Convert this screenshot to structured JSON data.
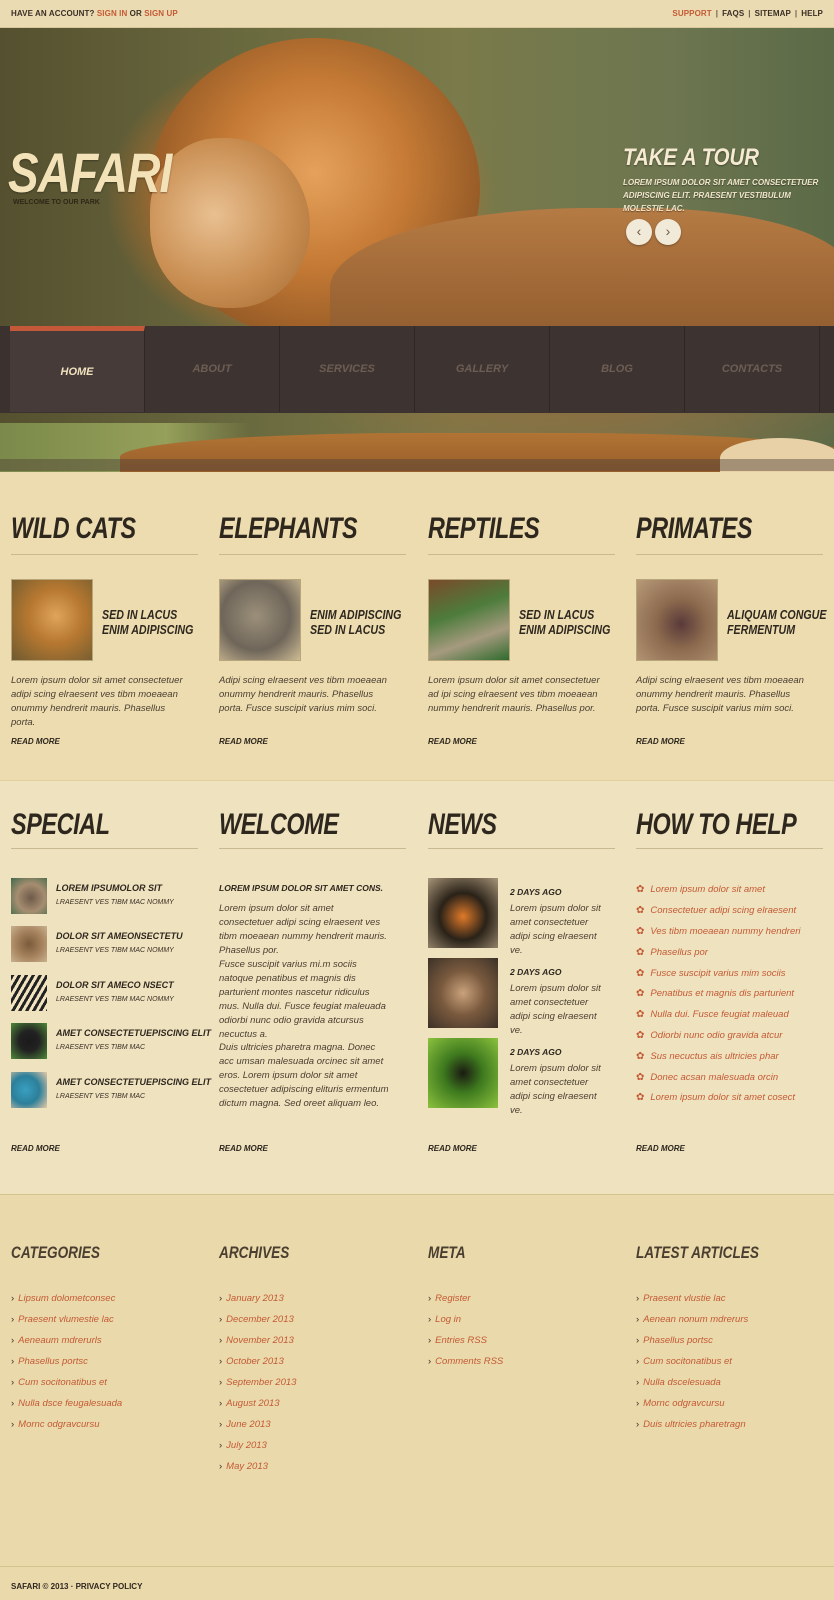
{
  "topbar": {
    "account_prefix": "HAVE AN ACCOUNT?",
    "sign_in": "SIGN IN",
    "or": "OR",
    "sign_up": "SIGN UP",
    "links": [
      "SUPPORT",
      "FAQS",
      "SITEMAP",
      "HELP"
    ]
  },
  "hero": {
    "logo": "SAFARI",
    "tagline": "WELCOME TO OUR PARK",
    "tour_title": "TAKE A TOUR",
    "tour_text": "LOREM IPSUM DOLOR SIT AMET CONSECTETUER ADIPISCING ELIT. PRAESENT VESTIBULUM MOLESTIE LAC.",
    "prev_icon": "‹",
    "next_icon": "›"
  },
  "nav": {
    "items": [
      "HOME",
      "ABOUT",
      "SERVICES",
      "GALLERY",
      "BLOG",
      "CONTACTS"
    ],
    "active": "HOME"
  },
  "categories": [
    {
      "heading": "WILD CATS",
      "title1": "SED IN LACUS",
      "title2": "ENIM ADIPISCING",
      "text": "Lorem ipsum dolor sit amet consectetuer adipi scing elraesent ves tibm moeaean onummy hendrerit mauris. Phasellus porta.",
      "read_more": "READ MORE"
    },
    {
      "heading": "ELEPHANTS",
      "title1": "ENIM ADIPISCING",
      "title2": "SED IN LACUS",
      "text": "Adipi scing elraesent ves tibm moeaean onummy hendrerit mauris. Phasellus porta. Fusce suscipit varius mim soci.",
      "read_more": "READ MORE"
    },
    {
      "heading": "REPTILES",
      "title1": "SED IN LACUS",
      "title2": "ENIM ADIPISCING",
      "text": "Lorem ipsum dolor sit amet consectetuer ad ipi scing elraesent ves tibm moeaean nummy hendrerit mauris. Phasellus por.",
      "read_more": "READ MORE"
    },
    {
      "heading": "PRIMATES",
      "title1": "ALIQUAM CONGUE",
      "title2": "FERMENTUM",
      "text": "Adipi scing elraesent ves tibm moeaean onummy hendrerit mauris. Phasellus porta. Fusce suscipit varius mim soci.",
      "read_more": "READ MORE"
    }
  ],
  "special": {
    "heading": "SPECIAL",
    "items": [
      {
        "title": "LOREM IPSUMOLOR SIT",
        "sub": "LRAESENT VES TIBM MAC NOMMY"
      },
      {
        "title": "DOLOR SIT AMEONSECTETU",
        "sub": "LRAESENT VES TIBM MAC NOMMY"
      },
      {
        "title": "DOLOR SIT AMECO NSECT",
        "sub": "LRAESENT VES TIBM MAC NOMMY"
      },
      {
        "title": "AMET CONSECTETUEPISCING ELIT",
        "sub": "LRAESENT VES TIBM MAC"
      },
      {
        "title": "AMET CONSECTETUEPISCING ELIT",
        "sub": "LRAESENT VES TIBM MAC"
      }
    ],
    "read_more": "READ MORE"
  },
  "welcome": {
    "heading": "WELCOME",
    "lead": "LOREM IPSUM DOLOR SIT AMET CONS.",
    "p1": "Lorem ipsum dolor sit amet consectetuer adipi scing elraesent ves tibm moeaean nummy hendrerit mauris. Phasellus por.",
    "p2": "Fusce suscipit varius mi.m sociis natoque penatibus et magnis dis parturient montes nascetur ridiculus mus. Nulla dui. Fusce feugiat maleuada odiorbi nunc odio gravida atcursus necuctus a.",
    "p3": "Duis ultricies pharetra magna. Donec acc umsan malesuada orcinec sit amet eros. Lorem ipsum dolor sit amet cosectetuer adipiscing elituris ermentum dictum magna. Sed oreet aliquam leo.",
    "read_more": "READ MORE"
  },
  "news": {
    "heading": "NEWS",
    "items": [
      {
        "date": "2 DAYS AGO",
        "text": "Lorem ipsum dolor sit amet consectetuer adipi scing elraesent ve."
      },
      {
        "date": "2 DAYS AGO",
        "text": "Lorem ipsum dolor sit amet consectetuer adipi scing elraesent ve."
      },
      {
        "date": "2 DAYS AGO",
        "text": "Lorem ipsum dolor sit amet consectetuer adipi scing elraesent ve."
      }
    ],
    "read_more": "READ MORE"
  },
  "help": {
    "heading": "HOW TO HELP",
    "items": [
      "Lorem ipsum dolor sit amet",
      "Consectetuer adipi scing elraesent",
      "Ves tibm moeaean nummy hendreri",
      "Phasellus por",
      "Fusce suscipit varius mim sociis",
      "Penatibus et magnis dis parturient",
      "Nulla dui. Fusce feugiat maleuad",
      "Odiorbi nunc odio gravida atcur",
      "Sus necuctus ais ultricies phar",
      "Donec acsan malesuada orcin",
      "Lorem ipsum dolor sit amet cosect"
    ],
    "read_more": "READ MORE"
  },
  "footer_cols": {
    "categories": {
      "title": "CATEGORIES",
      "links": [
        "Lipsum dolometconsec",
        "Praesent vlumestie lac",
        "Aeneaum mdrerurls",
        "Phasellus portsc",
        "Cum socitonatibus et",
        "Nulla dsce feugalesuada",
        "Mornc odgravcursu"
      ]
    },
    "archives": {
      "title": "ARCHIVES",
      "links": [
        "January 2013",
        "December 2013",
        "November 2013",
        "October 2013",
        "September 2013",
        "August 2013",
        "June 2013",
        "July 2013",
        "May 2013"
      ]
    },
    "meta": {
      "title": "META",
      "links": [
        "Register",
        "Log in",
        "Entries RSS",
        "Comments RSS"
      ]
    },
    "latest": {
      "title": "LATEST ARTICLES",
      "links": [
        "Praesent vlustie lac",
        "Aenean nonum mdrerurs",
        "Phasellus portsc",
        "Cum socitonatibus et",
        "Nulla dscelesuada",
        "Mornc odgravcursu",
        "Duis ultricies pharetragn"
      ]
    }
  },
  "footer": {
    "text": "SAFARI © 2013 · PRIVACY POLICY"
  }
}
